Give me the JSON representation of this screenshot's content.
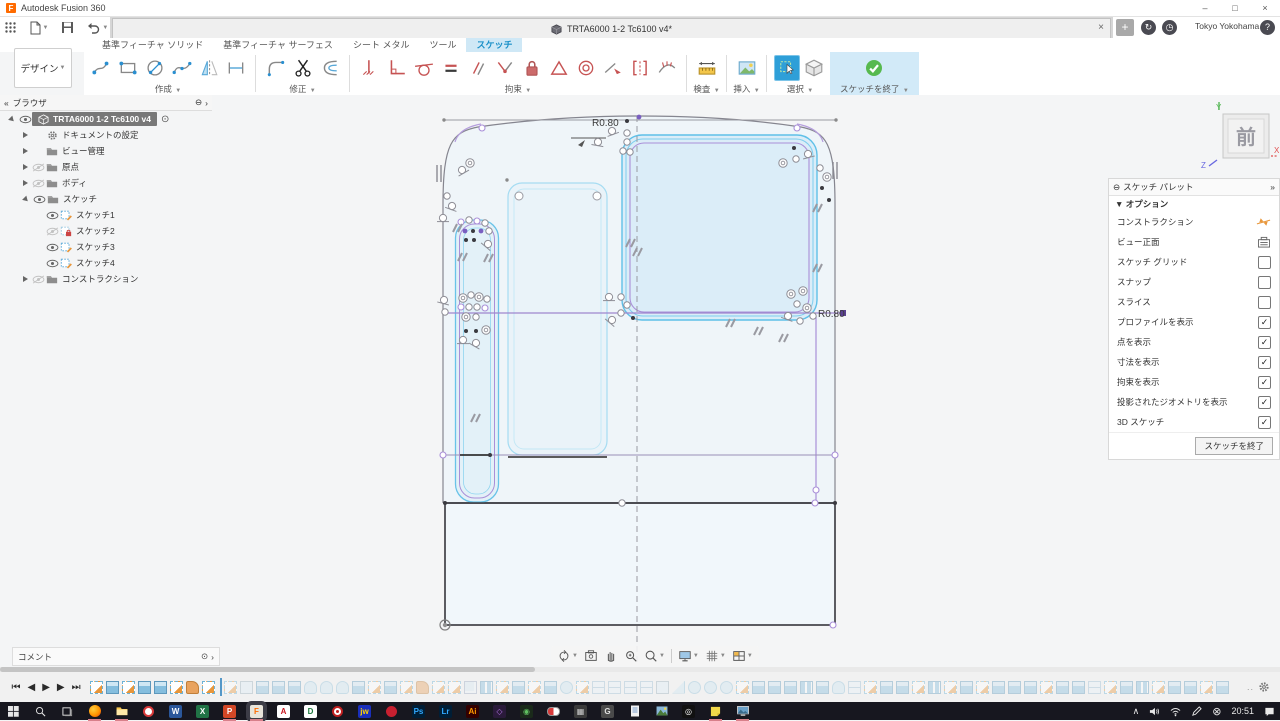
{
  "app": {
    "title": "Autodesk Fusion 360",
    "controls": [
      "–",
      "□",
      "×"
    ]
  },
  "tabbar": {
    "document_tab": "TRTA6000 1-2 Tc6100 v4*",
    "close_glyph": "×",
    "add_glyph": "+",
    "job_glyph": "↻",
    "recent_glyph": "◷",
    "account_location": "Tokyo Yokohama",
    "help_glyph": "?"
  },
  "ribbon": {
    "design_label": "デザイン",
    "design_caret": "▼",
    "tabs": [
      {
        "label": "基準フィーチャ ソリッド",
        "active": false
      },
      {
        "label": "基準フィーチャ サーフェス",
        "active": false
      },
      {
        "label": "シート メタル",
        "active": false
      },
      {
        "label": "ツール",
        "active": false
      },
      {
        "label": "スケッチ",
        "active": true
      }
    ],
    "groups": [
      {
        "label": "作成"
      },
      {
        "label": "修正"
      },
      {
        "label": "拘束"
      },
      {
        "label": "検査"
      },
      {
        "label": "挿入"
      },
      {
        "label": "選択"
      },
      {
        "label": "スケッチを終了"
      }
    ]
  },
  "browser": {
    "title": "ブラウザ",
    "collapse_glyph": "«",
    "minus_glyph": "⊖",
    "handle_glyph": "›",
    "target_glyph": "⊙",
    "items": [
      {
        "label": "TRTA6000 1-2 Tc6100 v4",
        "depth": 0,
        "arrow": "open",
        "eye": "on",
        "icon": "cube",
        "root": true
      },
      {
        "label": "ドキュメントの設定",
        "depth": 1,
        "arrow": "closed",
        "eye": null,
        "icon": "gear"
      },
      {
        "label": "ビュー管理",
        "depth": 1,
        "arrow": "closed",
        "eye": null,
        "icon": "folder"
      },
      {
        "label": "原点",
        "depth": 1,
        "arrow": "closed",
        "eye": "off",
        "icon": "folder"
      },
      {
        "label": "ボディ",
        "depth": 1,
        "arrow": "closed",
        "eye": "off",
        "icon": "folder"
      },
      {
        "label": "スケッチ",
        "depth": 1,
        "arrow": "open",
        "eye": "on",
        "icon": "folder"
      },
      {
        "label": "スケッチ1",
        "depth": 2,
        "arrow": null,
        "eye": "on",
        "icon": "sketch"
      },
      {
        "label": "スケッチ2",
        "depth": 2,
        "arrow": null,
        "eye": "off",
        "icon": "sketchlock"
      },
      {
        "label": "スケッチ3",
        "depth": 2,
        "arrow": null,
        "eye": "on",
        "icon": "sketch"
      },
      {
        "label": "スケッチ4",
        "depth": 2,
        "arrow": null,
        "eye": "on",
        "icon": "sketch"
      },
      {
        "label": "コンストラクション",
        "depth": 1,
        "arrow": "closed",
        "eye": "off",
        "icon": "folder"
      }
    ]
  },
  "palette": {
    "title": "スケッチ パレット",
    "collapse_glyph": "⊖",
    "handle_glyph": "»",
    "section": "▼ オプション",
    "rows": [
      {
        "label": "コンストラクション",
        "control": "construction"
      },
      {
        "label": "ビュー正面",
        "control": "viewfront"
      },
      {
        "label": "スケッチ グリッド",
        "control": "check",
        "checked": false
      },
      {
        "label": "スナップ",
        "control": "check",
        "checked": false
      },
      {
        "label": "スライス",
        "control": "check",
        "checked": false
      },
      {
        "label": "プロファイルを表示",
        "control": "check",
        "checked": true
      },
      {
        "label": "点を表示",
        "control": "check",
        "checked": true
      },
      {
        "label": "寸法を表示",
        "control": "check",
        "checked": true
      },
      {
        "label": "拘束を表示",
        "control": "check",
        "checked": true
      },
      {
        "label": "投影されたジオメトリを表示",
        "control": "check",
        "checked": true
      },
      {
        "label": "3D スケッチ",
        "control": "check",
        "checked": true
      }
    ],
    "check_glyph": "✓",
    "finish_button": "スケッチを終了"
  },
  "viewcube": {
    "face": "前",
    "axis_x": "X",
    "axis_y": "Y",
    "axis_z": "Z"
  },
  "sketch": {
    "labels": [
      {
        "text": "R0.80"
      },
      {
        "text": "R0.80"
      }
    ]
  },
  "comment": {
    "label": "コメント",
    "minus_glyph": "⊙",
    "handle_glyph": "›"
  },
  "timeline": {
    "marker_after": 8,
    "features": [
      "S",
      "E",
      "S",
      "E",
      "E",
      "S",
      "F",
      "S",
      "s",
      "b",
      "e",
      "e",
      "e",
      "r",
      "r",
      "r",
      "e",
      "s",
      "e",
      "s",
      "f",
      "s",
      "s",
      "g",
      "p",
      "s",
      "e",
      "s",
      "e",
      "c",
      "s",
      "h",
      "h",
      "h",
      "h",
      "b",
      "w",
      "c",
      "c",
      "c",
      "s",
      "e",
      "e",
      "e",
      "p",
      "e",
      "r",
      "h",
      "s",
      "e",
      "e",
      "s",
      "p",
      "s",
      "e",
      "s",
      "e",
      "e",
      "e",
      "s",
      "e",
      "e",
      "h",
      "s",
      "e",
      "p",
      "s",
      "e",
      "e",
      "s",
      "e"
    ],
    "dots": "..",
    "controls": [
      "⏮",
      "◀",
      "▶",
      "▶",
      "⏭"
    ]
  },
  "taskbar": {
    "time": "20:51",
    "chevron": "∧",
    "error_glyph": "⊗",
    "icons": [
      {
        "n": "start"
      },
      {
        "n": "search"
      },
      {
        "n": "taskview"
      },
      {
        "n": "firefox",
        "run": true
      },
      {
        "n": "explorer",
        "run": true
      },
      {
        "n": "pin-red"
      },
      {
        "n": "word",
        "glyph": "W",
        "bg": "#2b579a",
        "fg": "#ffffff"
      },
      {
        "n": "excel",
        "glyph": "X",
        "bg": "#217346",
        "fg": "#ffffff"
      },
      {
        "n": "powerpoint",
        "glyph": "P",
        "bg": "#d24726",
        "fg": "#ffffff",
        "run": true
      },
      {
        "n": "fusion",
        "glyph": "F",
        "bg": "#e8e4da",
        "fg": "#ff6b00",
        "active": true
      },
      {
        "n": "acrobat",
        "glyph": "A",
        "bg": "#ffffff",
        "fg": "#c81720"
      },
      {
        "n": "d-app",
        "glyph": "D",
        "bg": "#ffffff",
        "fg": "#1d7a3e"
      },
      {
        "n": "target-red"
      },
      {
        "n": "jwcad",
        "glyph": "jw",
        "bg": "#1a2fbb",
        "fg": "#ffd400"
      },
      {
        "n": "red-badge"
      },
      {
        "n": "photoshop",
        "glyph": "Ps",
        "bg": "#001e36",
        "fg": "#31a8ff"
      },
      {
        "n": "lightroom",
        "glyph": "Lr",
        "bg": "#001e36",
        "fg": "#31a8ff"
      },
      {
        "n": "illustrator",
        "glyph": "Ai",
        "bg": "#330000",
        "fg": "#ff9a00"
      },
      {
        "n": "diamond",
        "glyph": "◇",
        "bg": "#2a1a3a",
        "fg": "#b070e0"
      },
      {
        "n": "obs",
        "glyph": "◉",
        "bg": "#1a2a1a",
        "fg": "#60c060"
      },
      {
        "n": "capsule"
      },
      {
        "n": "grid-app",
        "glyph": "▦",
        "bg": "#3a3a3a",
        "fg": "#cccccc"
      },
      {
        "n": "gimp",
        "glyph": "G",
        "bg": "#4a4a4a",
        "fg": "#e0e0e0"
      },
      {
        "n": "notes"
      },
      {
        "n": "photos"
      },
      {
        "n": "record",
        "glyph": "◎",
        "bg": "#111111",
        "fg": "#ffffff"
      },
      {
        "n": "sticky",
        "run": true
      },
      {
        "n": "display-app",
        "run": true
      }
    ]
  }
}
